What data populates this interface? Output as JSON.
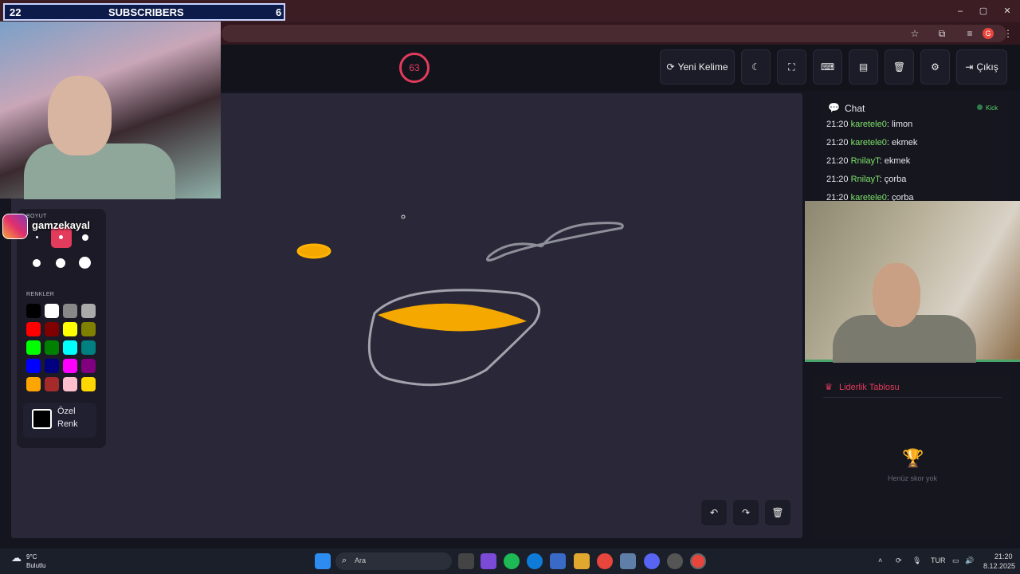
{
  "stream_overlay": {
    "subscribers_count": "22",
    "subscribers_label": "SUBSCRIBERS",
    "subscribers_goal": "6",
    "instagram_handle": "gamzekayal"
  },
  "browser": {
    "minimize": "–",
    "maximize": "▢",
    "close": "✕",
    "profile_initial": "G"
  },
  "game": {
    "timer": "63",
    "buttons": {
      "new_word": "Yeni Kelime",
      "exit": "Çıkış"
    },
    "tools": {
      "size_label": "BOYUT",
      "colors_label": "RENKLER",
      "custom_color_line1": "Özel",
      "custom_color_line2": "Renk"
    },
    "palette": [
      "#000000",
      "#ffffff",
      "#888888",
      "#aaaaaa",
      "#ff0000",
      "#800000",
      "#ffff00",
      "#808000",
      "#00ff00",
      "#008000",
      "#00ffff",
      "#008080",
      "#0000ff",
      "#000080",
      "#ff00ff",
      "#800080",
      "#ffa500",
      "#a52a2a",
      "#ffc0cb",
      "#ffd700"
    ],
    "chat": {
      "title": "Chat",
      "platform": "Kick",
      "messages": [
        {
          "time": "21:20",
          "user": "karetele0",
          "text": "limon"
        },
        {
          "time": "21:20",
          "user": "karetele0",
          "text": "ekmek"
        },
        {
          "time": "21:20",
          "user": "RnilayT",
          "text": "ekmek"
        },
        {
          "time": "21:20",
          "user": "RnilayT",
          "text": "çorba"
        },
        {
          "time": "21:20",
          "user": "karetele0",
          "text": "çorba"
        }
      ]
    },
    "leaderboard": {
      "title": "Liderlik Tablosu",
      "empty_text": "Henüz skor yok"
    }
  },
  "taskbar": {
    "weather_temp": "9°C",
    "weather_desc": "Bulutlu",
    "search_placeholder": "Ara",
    "language": "TUR",
    "time": "21:20",
    "date": "8.12.2025"
  }
}
